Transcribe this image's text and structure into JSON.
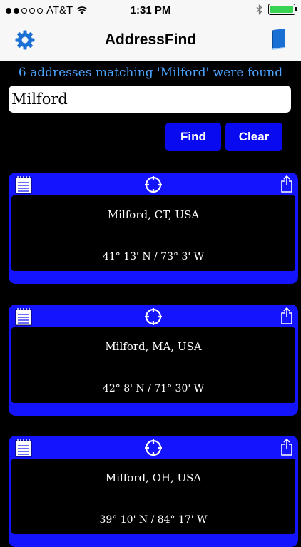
{
  "status_bar": {
    "carrier": "AT&T",
    "time": "1:31 PM",
    "signal_bars": 2,
    "battery_level": 1.0
  },
  "nav": {
    "title": "AddressFind",
    "left_icon": "gear-icon",
    "right_icon": "book-icon"
  },
  "search": {
    "message": "6 addresses matching 'Milford' were found",
    "value": "Milford",
    "find_label": "Find",
    "clear_label": "Clear"
  },
  "results": [
    {
      "place": "Milford, CT, USA",
      "coords": "41° 13' N / 73° 3' W"
    },
    {
      "place": "Milford, MA, USA",
      "coords": "42° 8' N / 71° 30' W"
    },
    {
      "place": "Milford, OH, USA",
      "coords": "39° 10' N / 84° 17' W"
    }
  ],
  "colors": {
    "accent": "#0a0af0",
    "card": "#1414ff",
    "message": "#4aa3ff",
    "icon_blue": "#1a6fd4"
  }
}
